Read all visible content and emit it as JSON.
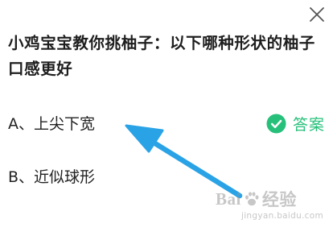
{
  "question": {
    "text": "小鸡宝宝教你挑柚子：以下哪种形状的柚子口感更好"
  },
  "options": [
    {
      "label": "A、上尖下宽"
    },
    {
      "label": "B、近似球形"
    }
  ],
  "answer_tag": {
    "label": "答案",
    "color": "#27c07a",
    "icon": "check-circle-icon"
  },
  "close": {
    "icon": "close-icon"
  },
  "annotation": {
    "icon": "arrow-icon",
    "color": "#2aa3e6"
  },
  "watermark": {
    "brand": "Baidu 经验",
    "url": "jingyan.baidu.com"
  }
}
